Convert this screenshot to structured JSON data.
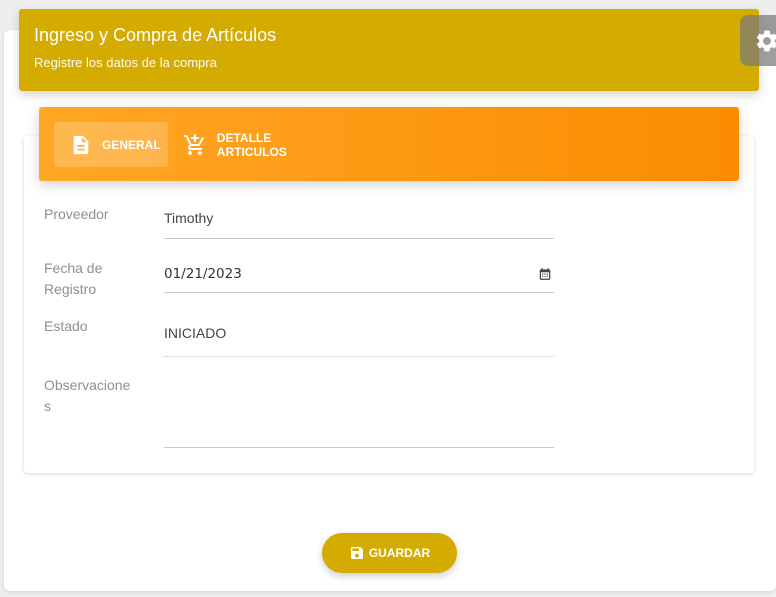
{
  "header": {
    "title": "Ingreso y Compra de Artículos",
    "subtitle": "Registre los datos de la compra"
  },
  "tabs": [
    {
      "label": "GENERAL",
      "icon": "document-icon",
      "active": true
    },
    {
      "label": "DETALLE ARTICULOS",
      "icon": "cart-add-icon",
      "active": false
    }
  ],
  "form": {
    "proveedor": {
      "label": "Proveedor",
      "value": "Timothy"
    },
    "fecha": {
      "label_line1": "Fecha de",
      "label_line2": "Registro",
      "value": "01/21/2023"
    },
    "estado": {
      "label": "Estado",
      "value": "INICIADO"
    },
    "observaciones": {
      "label_line1": "Observacione",
      "label_line2": "s",
      "value": ""
    }
  },
  "actions": {
    "save_label": "GUARDAR"
  },
  "colors": {
    "primary": "#d4ab00",
    "tab_gradient_start": "#ffa726",
    "tab_gradient_end": "#fb8c00"
  }
}
